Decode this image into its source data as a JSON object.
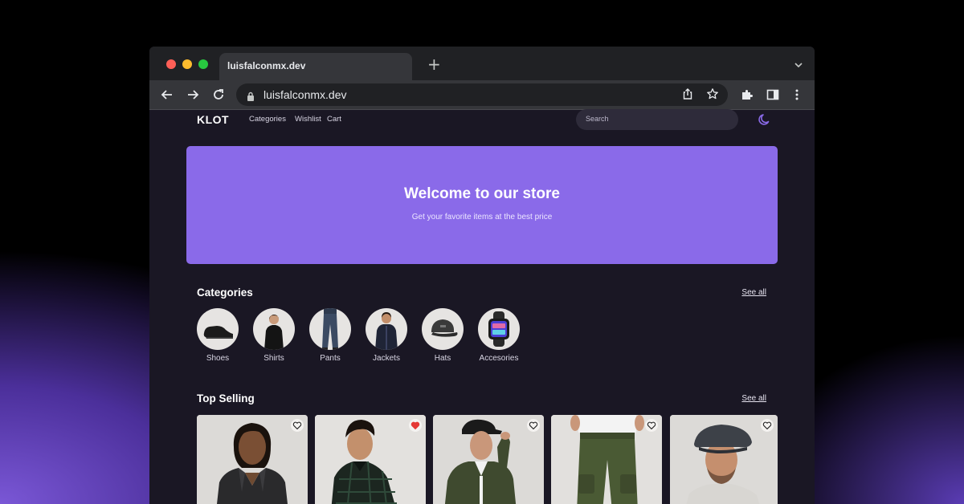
{
  "browser": {
    "tab_title": "luisfalconmx.dev",
    "url": "luisfalconmx.dev",
    "new_tab_symbol": "+"
  },
  "site": {
    "logo": "KLOT",
    "nav": [
      "Categories",
      "Wishlist",
      "Cart"
    ],
    "search_placeholder": "Search",
    "theme_icon": "moon-icon"
  },
  "hero": {
    "title": "Welcome to our store",
    "subtitle": "Get your favorite items at the best price"
  },
  "categories": {
    "title": "Categories",
    "see_all": "See all",
    "items": [
      {
        "label": "Shoes",
        "icon": "shoe-image"
      },
      {
        "label": "Shirts",
        "icon": "shirt-image"
      },
      {
        "label": "Pants",
        "icon": "pants-image"
      },
      {
        "label": "Jackets",
        "icon": "jacket-image"
      },
      {
        "label": "Hats",
        "icon": "hat-image"
      },
      {
        "label": "Accesories",
        "icon": "watch-image"
      }
    ]
  },
  "top_selling": {
    "title": "Top Selling",
    "see_all": "See all",
    "products": [
      {
        "image": "leather-jacket-photo",
        "favorited": false
      },
      {
        "image": "plaid-shirt-photo",
        "favorited": true
      },
      {
        "image": "green-jacket-photo",
        "favorited": false
      },
      {
        "image": "cargo-pants-photo",
        "favorited": false
      },
      {
        "image": "flat-cap-photo",
        "favorited": false
      }
    ]
  },
  "colors": {
    "accent": "#8a6ae9",
    "heart_active": "#e53935",
    "page_bg": "#1a1724"
  }
}
